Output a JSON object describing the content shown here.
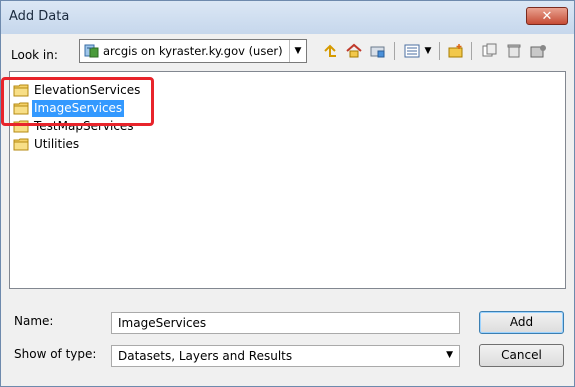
{
  "window": {
    "title": "Add Data",
    "close_glyph": "✕"
  },
  "toolbar": {
    "look_in_label": "Look in:",
    "location": "arcgis on kyraster.ky.gov (user)",
    "buttons": [
      "up-one-level-icon",
      "home-icon",
      "connect-folder-icon",
      "list-view-icon",
      "new-folder-icon",
      "copy-icon",
      "delete-icon",
      "catalog-icon"
    ]
  },
  "list": {
    "items": [
      {
        "label": "ElevationServices",
        "selected": false
      },
      {
        "label": "ImageServices",
        "selected": true
      },
      {
        "label": "TestMapServices",
        "selected": false
      },
      {
        "label": "Utilities",
        "selected": false
      }
    ]
  },
  "form": {
    "name_label": "Name:",
    "name_value": "ImageServices",
    "type_label": "Show of type:",
    "type_value": "Datasets, Layers and Results"
  },
  "buttons": {
    "add": "Add",
    "cancel": "Cancel"
  },
  "colors": {
    "selection": "#3399ff",
    "annotation": "#e8242b",
    "title_bar": "#c6d7ec",
    "close": "#c64c36"
  }
}
